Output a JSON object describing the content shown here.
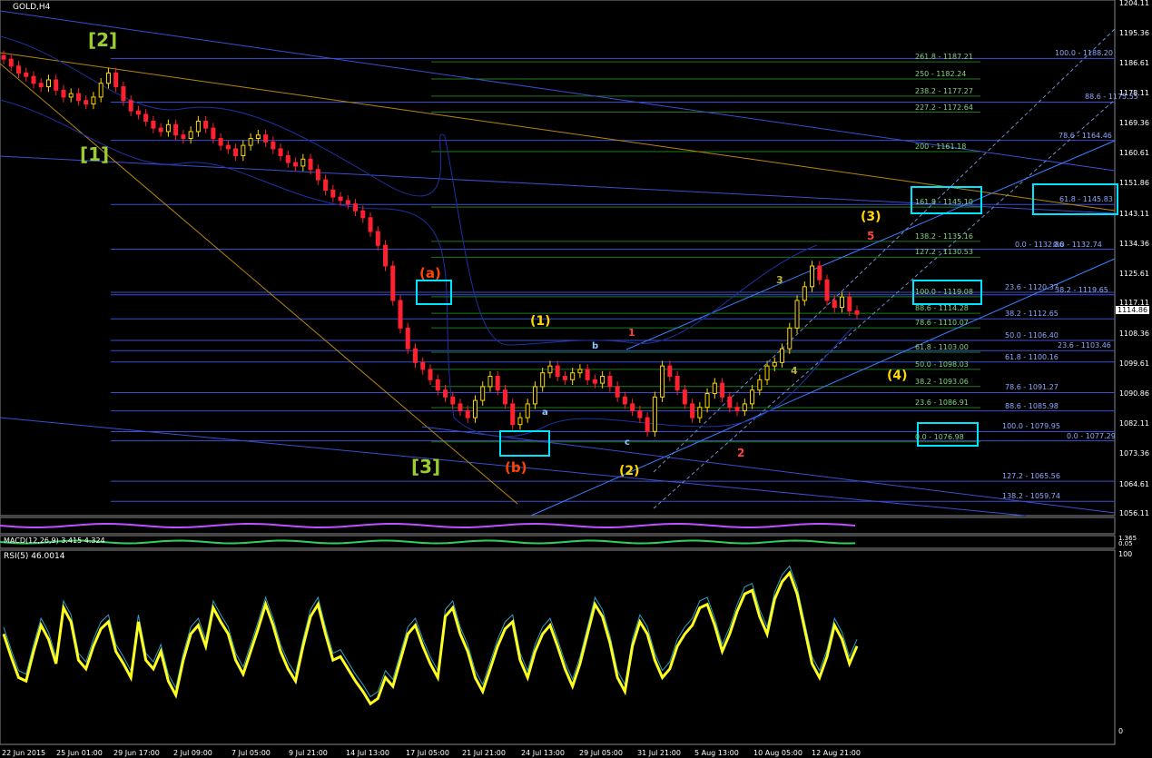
{
  "header": {
    "symbol": "GOLD,H4",
    "macd_label": "MACD(12,26,9) 3.415 4.324",
    "rsi_label": "RSI(5) 46.0014"
  },
  "chart_data": {
    "type": "candlestick",
    "symbol": "GOLD,H4",
    "price_axis": [
      "1204.11",
      "1195.36",
      "1186.61",
      "1178.11",
      "1169.36",
      "1160.61",
      "1151.86",
      "1143.11",
      "1134.36",
      "1125.61",
      "1117.11",
      "1108.36",
      "1099.61",
      "1090.86",
      "1082.11",
      "1073.36",
      "1064.61",
      "1056.11"
    ],
    "current_price": "1114.86",
    "dates": [
      "22 Jun 2015",
      "25 Jun 01:00",
      "29 Jun 17:00",
      "2 Jul 09:00",
      "7 Jul 05:00",
      "9 Jul 21:00",
      "14 Jul 13:00",
      "17 Jul 05:00",
      "21 Jul 21:00",
      "24 Jul 13:00",
      "29 Jul 05:00",
      "31 Jul 21:00",
      "5 Aug 13:00",
      "10 Aug 05:00",
      "12 Aug 21:00"
    ],
    "fib_green": [
      "261.8 - 1187.21",
      "250 - 1182.24",
      "238.2 - 1177.27",
      "227.2 - 1172.64",
      "200 - 1161.18",
      "161.8 - 1145.10",
      "138.2 - 1135.16",
      "127.2 - 1130.53",
      "100.0 - 1119.08",
      "88.6 - 1114.28",
      "78.6 - 1110.07",
      "61.8 - 1103.00",
      "50.0 - 1098.03",
      "38.2 - 1093.06",
      "23.6 - 1086.91",
      "0.0 - 1076.98"
    ],
    "fib_blue": [
      "100.0 - 1188.20",
      "88.6 - 1175.55",
      "78.6 - 1164.46",
      "61.8 - 1145.83",
      "0.0 - 1132.86",
      "0.0 - 1132.74",
      "23.6 - 1120.37",
      "38.2 - 1119.65",
      "38.2 - 1112.65",
      "50.0 - 1106.40",
      "23.6 - 1103.46",
      "61.8 - 1100.16",
      "78.6 - 1091.27",
      "88.6 - 1085.98",
      "100.0 - 1079.95",
      "0.0 - 1077.29",
      "127.2 - 1065.56",
      "138.2 - 1059.74"
    ],
    "waves": [
      "[2]",
      "[1]",
      "[3]",
      "(a)",
      "(b)",
      "(1)",
      "(2)",
      "(3)",
      "(4)",
      "a",
      "b",
      "c",
      "1",
      "2",
      "3",
      "4",
      "5"
    ],
    "rsi_axis": [
      "100",
      "0"
    ],
    "macd_axis": [
      "1.365",
      "0.05"
    ]
  }
}
